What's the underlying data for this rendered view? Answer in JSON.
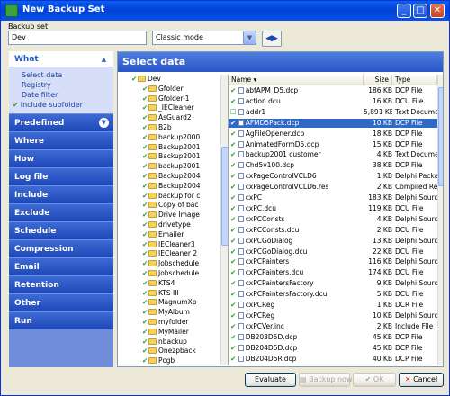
{
  "window": {
    "title": "New Backup Set"
  },
  "backup_set": {
    "label": "Backup set",
    "name": "Dev",
    "mode": "Classic mode"
  },
  "sidebar": {
    "what": {
      "title": "What",
      "items": [
        "Select data",
        "Registry",
        "Date filter",
        "Include subfolder"
      ]
    },
    "categories": [
      "Predefined",
      "Where",
      "How",
      "Log file",
      "Include",
      "Exclude",
      "Schedule",
      "Compression",
      "Email",
      "Retention",
      "Other",
      "Run"
    ]
  },
  "content": {
    "title": "Select data",
    "tree": [
      "Dev",
      "Gfolder",
      "Gfolder-1",
      "_IECleaner",
      "AsGuard2",
      "B2b",
      "backup2000",
      "Backup2001",
      "Backup2001",
      "backup2001",
      "Backup2004",
      "Backup2004",
      "backup for c",
      "Copy of bac",
      "Drive Image",
      "drivetype",
      "Emailer",
      "IECleaner3",
      "IECleaner 2",
      "Jobschedule",
      "Jobschedule",
      "KTS4",
      "KTS III",
      "MagnumXp",
      "MyAlbum",
      "myfolder",
      "MyMailer",
      "nbackup",
      "Onezpback",
      "Pcgb"
    ],
    "list": {
      "columns": [
        "Name",
        "Size",
        "Type"
      ],
      "rows": [
        {
          "name": "abfAPM_D5.dcp",
          "size": "186 KB",
          "type": "DCP File",
          "checked": true
        },
        {
          "name": "action.dcu",
          "size": "16 KB",
          "type": "DCU File",
          "checked": true
        },
        {
          "name": "addr1",
          "size": "5,891 KB",
          "type": "Text Document",
          "checked": false
        },
        {
          "name": "AFMD5Pack.dcp",
          "size": "10 KB",
          "type": "DCP File",
          "checked": true,
          "selected": true
        },
        {
          "name": "AgFileOpener.dcp",
          "size": "18 KB",
          "type": "DCP File",
          "checked": true
        },
        {
          "name": "AnimatedFormD5.dcp",
          "size": "15 KB",
          "type": "DCP File",
          "checked": true
        },
        {
          "name": "backup2001 customer",
          "size": "4 KB",
          "type": "Text Document",
          "checked": true
        },
        {
          "name": "Chd5v100.dcp",
          "size": "38 KB",
          "type": "DCP File",
          "checked": true
        },
        {
          "name": "cxPageControlVCLD6",
          "size": "1 KB",
          "type": "Delphi Package",
          "checked": true
        },
        {
          "name": "cxPageControlVCLD6.res",
          "size": "2 KB",
          "type": "Compiled Reso",
          "checked": true
        },
        {
          "name": "cxPC",
          "size": "183 KB",
          "type": "Delphi Source I",
          "checked": true
        },
        {
          "name": "cxPC.dcu",
          "size": "119 KB",
          "type": "DCU File",
          "checked": true
        },
        {
          "name": "cxPCConsts",
          "size": "4 KB",
          "type": "Delphi Source I",
          "checked": true
        },
        {
          "name": "cxPCConsts.dcu",
          "size": "2 KB",
          "type": "DCU File",
          "checked": true
        },
        {
          "name": "cxPCGoDialog",
          "size": "13 KB",
          "type": "Delphi Source I",
          "checked": true
        },
        {
          "name": "cxPCGoDialog.dcu",
          "size": "22 KB",
          "type": "DCU File",
          "checked": true
        },
        {
          "name": "cxPCPainters",
          "size": "116 KB",
          "type": "Delphi Source I",
          "checked": true
        },
        {
          "name": "cxPCPainters.dcu",
          "size": "174 KB",
          "type": "DCU File",
          "checked": true
        },
        {
          "name": "cxPCPaintersFactory",
          "size": "9 KB",
          "type": "Delphi Source I",
          "checked": true
        },
        {
          "name": "cxPCPaintersFactory.dcu",
          "size": "5 KB",
          "type": "DCU File",
          "checked": true
        },
        {
          "name": "cxPCReg",
          "size": "1 KB",
          "type": "DCR File",
          "checked": true
        },
        {
          "name": "cxPCReg",
          "size": "10 KB",
          "type": "Delphi Source I",
          "checked": true
        },
        {
          "name": "cxPCVer.inc",
          "size": "2 KB",
          "type": "Include File",
          "checked": true
        },
        {
          "name": "DB203D5D.dcp",
          "size": "45 KB",
          "type": "DCP File",
          "checked": true
        },
        {
          "name": "DB204D5D.dcp",
          "size": "45 KB",
          "type": "DCP File",
          "checked": true
        },
        {
          "name": "DB204D5R.dcp",
          "size": "40 KB",
          "type": "DCP File",
          "checked": true
        }
      ]
    }
  },
  "buttons": {
    "evaluate": "Evaluate",
    "backup_now": "Backup now",
    "ok": "OK",
    "cancel": "Cancel"
  },
  "colors": {
    "accent": "#316AC5",
    "sidebar": "#6F8DDB",
    "titlebar": "#0A51E8",
    "check": "#2AA02A"
  }
}
